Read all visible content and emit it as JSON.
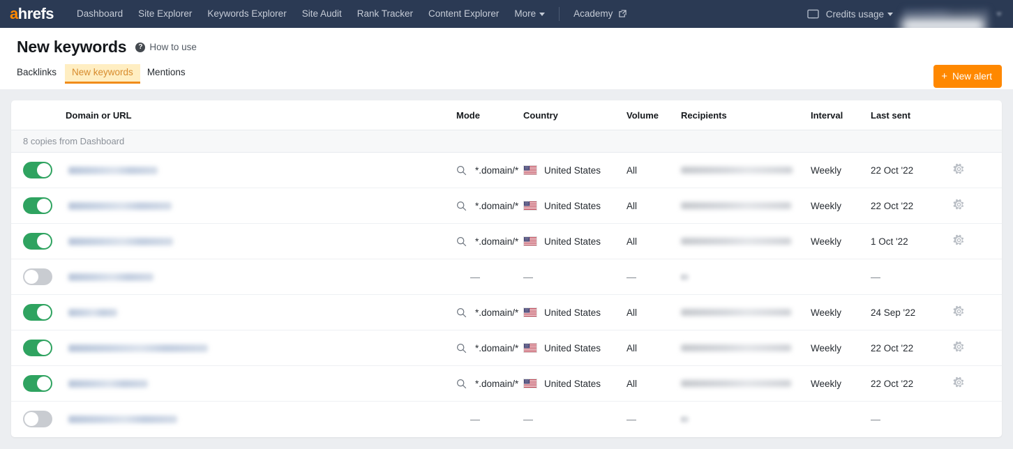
{
  "topnav": {
    "logo": "ahrefs",
    "logo_first_letter": "a",
    "logo_rest": "hrefs",
    "links": [
      {
        "label": "Dashboard",
        "name": "nav-dashboard"
      },
      {
        "label": "Site Explorer",
        "name": "nav-site-explorer"
      },
      {
        "label": "Keywords Explorer",
        "name": "nav-keywords-explorer"
      },
      {
        "label": "Site Audit",
        "name": "nav-site-audit"
      },
      {
        "label": "Rank Tracker",
        "name": "nav-rank-tracker"
      },
      {
        "label": "Content Explorer",
        "name": "nav-content-explorer"
      },
      {
        "label": "More",
        "name": "nav-more",
        "has_caret": true
      }
    ],
    "academy": "Academy",
    "credits_usage": "Credits usage",
    "account_name": "",
    "colors": {
      "bar": "#2b3a54",
      "logo_accent": "#ff8800",
      "link": "#c5cbd6"
    }
  },
  "header": {
    "title": "New keywords",
    "help_icon_glyph": "?",
    "help_label": "How to use",
    "tabs": [
      {
        "label": "Backlinks",
        "active": false
      },
      {
        "label": "New keywords",
        "active": true
      },
      {
        "label": "Mentions",
        "active": false
      }
    ],
    "new_alert_button": {
      "plus": "+",
      "label": "New alert",
      "color": "#ff8800"
    },
    "active_tab_colors": {
      "bg": "#ffeec2",
      "text": "#d78b2d",
      "underline": "#f08c1a"
    }
  },
  "table": {
    "columns": [
      "Domain or URL",
      "Mode",
      "Country",
      "Volume",
      "Recipients",
      "Interval",
      "Last sent"
    ],
    "group_label": "8 copies from Dashboard",
    "empty_value": "—",
    "rows": [
      {
        "enabled": true,
        "domain_blur_width": 128,
        "mode": "*.domain/*",
        "country": "United States",
        "country_flag": "us-flag-icon",
        "volume": "All",
        "recipients_blur_width": 160,
        "interval": "Weekly",
        "last_sent": "22 Oct '22",
        "has_gear": true,
        "has_search_icon": true
      },
      {
        "enabled": true,
        "domain_blur_width": 148,
        "mode": "*.domain/*",
        "country": "United States",
        "country_flag": "us-flag-icon",
        "volume": "All",
        "recipients_blur_width": 158,
        "interval": "Weekly",
        "last_sent": "22 Oct '22",
        "has_gear": true,
        "has_search_icon": true
      },
      {
        "enabled": true,
        "domain_blur_width": 150,
        "mode": "*.domain/*",
        "country": "United States",
        "country_flag": "us-flag-icon",
        "volume": "All",
        "recipients_blur_width": 158,
        "interval": "Weekly",
        "last_sent": "1 Oct '22",
        "has_gear": true,
        "has_search_icon": true
      },
      {
        "enabled": false,
        "domain_blur_width": 122,
        "mode": "—",
        "country": "—",
        "volume": "—",
        "recipients_blur_width": 11,
        "interval": "",
        "last_sent": "—",
        "has_gear": false,
        "has_search_icon": false
      },
      {
        "enabled": true,
        "domain_blur_width": 70,
        "mode": "*.domain/*",
        "country": "United States",
        "country_flag": "us-flag-icon",
        "volume": "All",
        "recipients_blur_width": 158,
        "interval": "Weekly",
        "last_sent": "24 Sep '22",
        "has_gear": true,
        "has_search_icon": true
      },
      {
        "enabled": true,
        "domain_blur_width": 200,
        "mode": "*.domain/*",
        "country": "United States",
        "country_flag": "us-flag-icon",
        "volume": "All",
        "recipients_blur_width": 158,
        "interval": "Weekly",
        "last_sent": "22 Oct '22",
        "has_gear": true,
        "has_search_icon": true
      },
      {
        "enabled": true,
        "domain_blur_width": 114,
        "mode": "*.domain/*",
        "country": "United States",
        "country_flag": "us-flag-icon",
        "volume": "All",
        "recipients_blur_width": 158,
        "interval": "Weekly",
        "last_sent": "22 Oct '22",
        "has_gear": true,
        "has_search_icon": true
      },
      {
        "enabled": false,
        "domain_blur_width": 156,
        "mode": "—",
        "country": "—",
        "volume": "—",
        "recipients_blur_width": 11,
        "interval": "",
        "last_sent": "—",
        "has_gear": false,
        "has_search_icon": false
      }
    ]
  }
}
